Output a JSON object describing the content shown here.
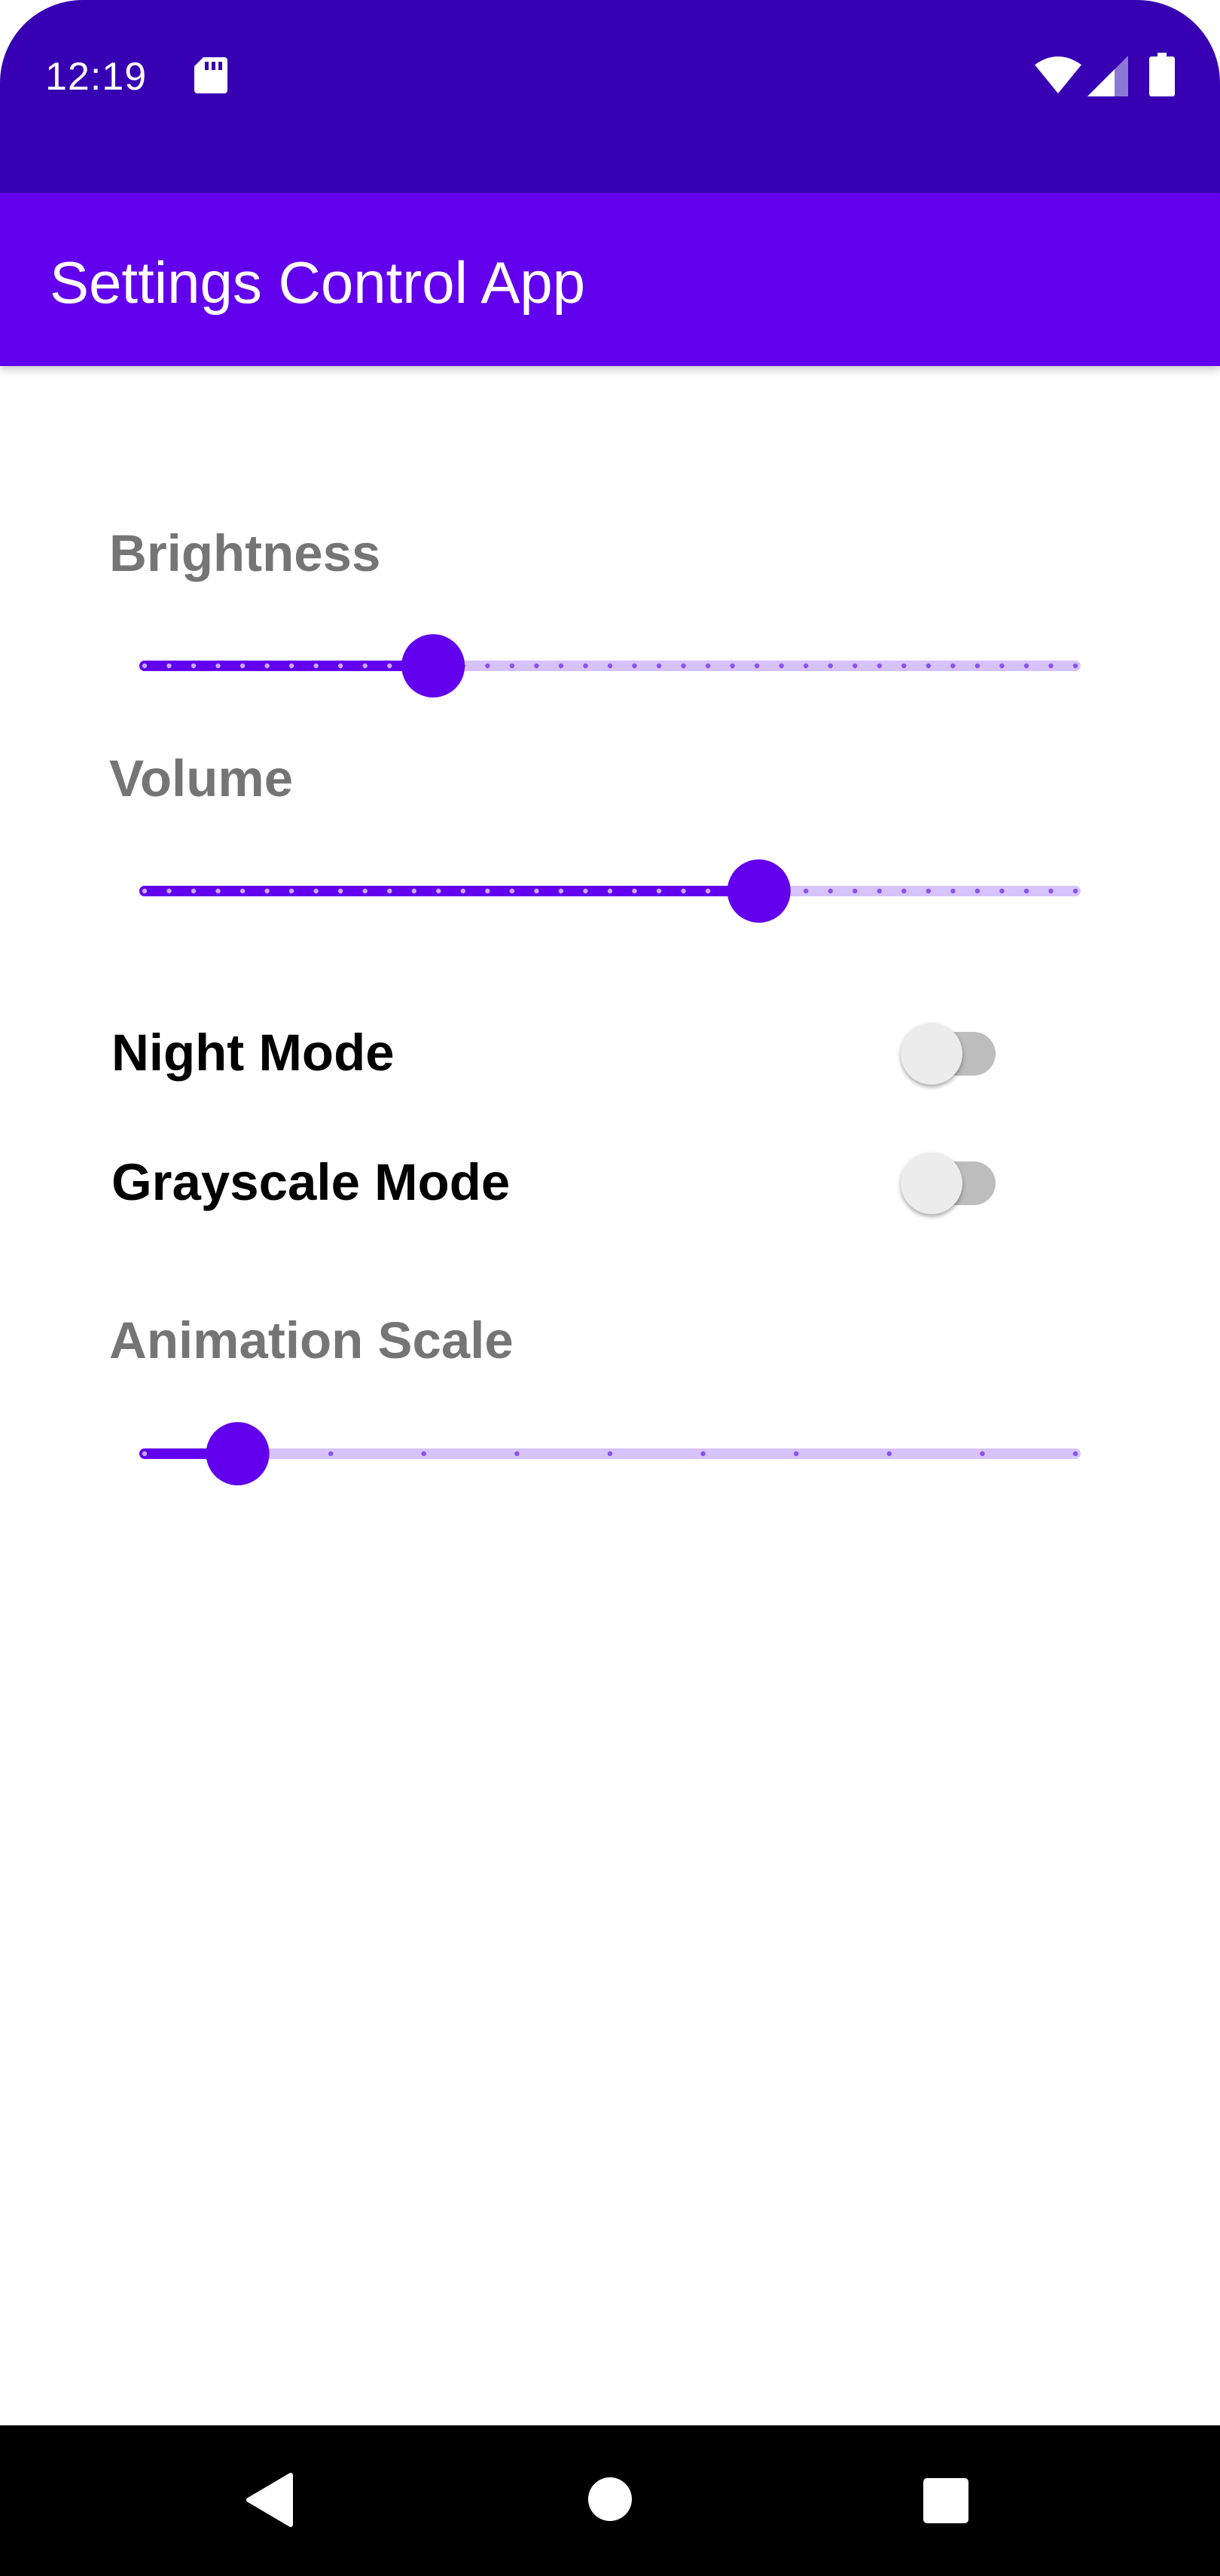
{
  "status_bar": {
    "time": "12:19",
    "icons": [
      "sd-card-icon",
      "wifi-icon",
      "cell-signal-icon",
      "battery-icon"
    ]
  },
  "app_bar": {
    "title": "Settings Control App"
  },
  "settings": {
    "brightness": {
      "label": "Brightness",
      "value_fraction": 0.31,
      "tick_count": 38
    },
    "volume": {
      "label": "Volume",
      "value_fraction": 0.66,
      "tick_count": 38
    },
    "night_mode": {
      "label": "Night Mode",
      "checked": false
    },
    "grayscale_mode": {
      "label": "Grayscale Mode",
      "checked": false
    },
    "animation_scale": {
      "label": "Animation Scale",
      "value_fraction": 0.1,
      "tick_count": 10
    }
  },
  "nav_bar": {
    "icons": [
      "back-icon",
      "home-icon",
      "recents-icon"
    ]
  },
  "colors": {
    "status_bar": "#3700b3",
    "primary": "#6200ee",
    "track_inactive": "#d7c3fb",
    "switch_track_off": "#bdbdbd",
    "switch_thumb_off": "#ececec",
    "label_gray": "#757575"
  }
}
